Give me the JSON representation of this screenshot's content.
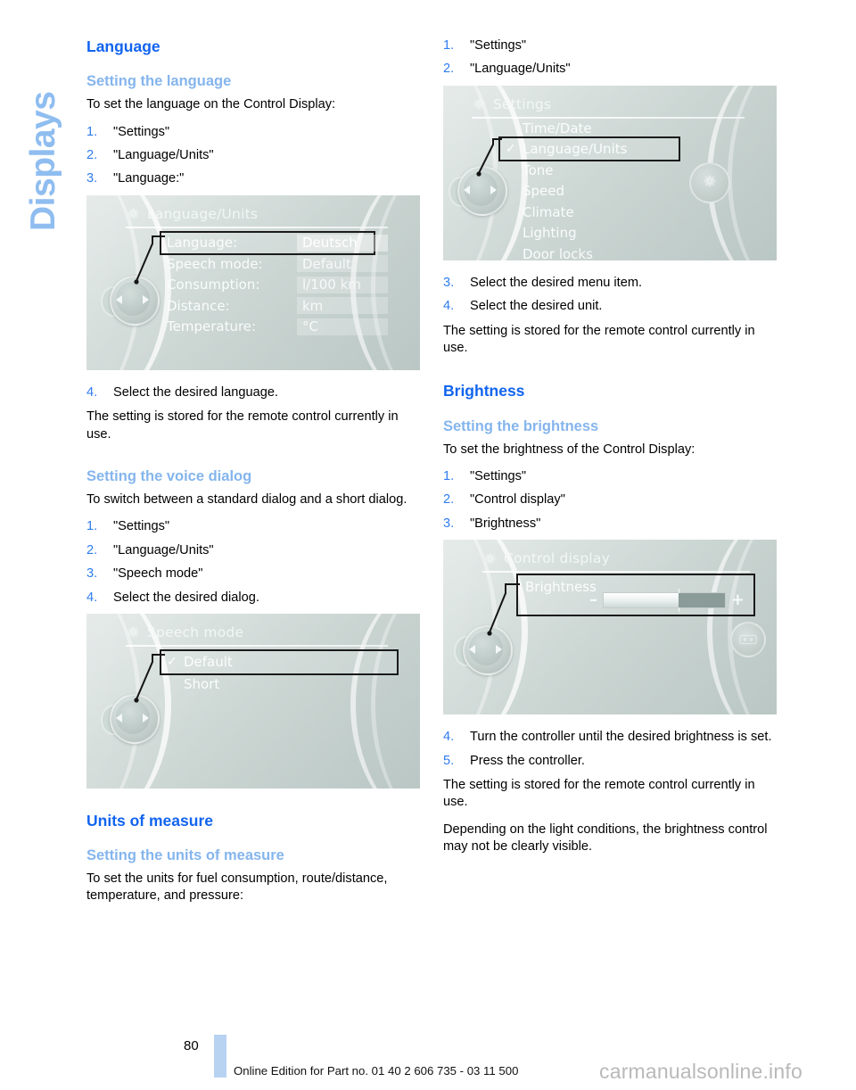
{
  "side_tab": {
    "label": "Displays"
  },
  "page": {
    "number": "80"
  },
  "footer": {
    "edition_text": "Online Edition for Part no. 01 40 2 606 735 - 03 11 500",
    "watermark": "carmanualsonline.info"
  },
  "left_column": {
    "section_title": "Language",
    "sub1": {
      "heading": "Setting the language",
      "intro": "To set the language on the Control Display:",
      "steps": [
        {
          "num": "1.",
          "text": "\"Settings\""
        },
        {
          "num": "2.",
          "text": "\"Language/Units\""
        },
        {
          "num": "3.",
          "text": "\"Language:\""
        }
      ],
      "after_steps": [
        {
          "num": "4.",
          "text": "Select the desired language."
        }
      ],
      "note": "The setting is stored for the remote control currently in use."
    },
    "sub2": {
      "heading": "Setting the voice dialog",
      "intro": "To switch between a standard dialog and a short dialog.",
      "steps": [
        {
          "num": "1.",
          "text": "\"Settings\""
        },
        {
          "num": "2.",
          "text": "\"Language/Units\""
        },
        {
          "num": "3.",
          "text": "\"Speech mode\""
        },
        {
          "num": "4.",
          "text": "Select the desired dialog."
        }
      ]
    },
    "section_title2": "Units of measure",
    "sub3": {
      "heading": "Setting the units of measure",
      "intro": "To set the units for fuel consumption, route/distance, temperature, and pressure:"
    }
  },
  "right_column": {
    "steps_top": [
      {
        "num": "1.",
        "text": "\"Settings\""
      },
      {
        "num": "2.",
        "text": "\"Language/Units\""
      }
    ],
    "steps_mid": [
      {
        "num": "3.",
        "text": "Select the desired menu item."
      },
      {
        "num": "4.",
        "text": "Select the desired unit."
      }
    ],
    "note1": "The setting is stored for the remote control currently in use.",
    "section_title": "Brightness",
    "sub1": {
      "heading": "Setting the brightness",
      "intro": "To set the brightness of the Control Display:",
      "steps": [
        {
          "num": "1.",
          "text": "\"Settings\""
        },
        {
          "num": "2.",
          "text": "\"Control display\""
        },
        {
          "num": "3.",
          "text": "\"Brightness\""
        }
      ]
    },
    "steps_bottom": [
      {
        "num": "4.",
        "text": "Turn the controller until the desired brightness is set."
      },
      {
        "num": "5.",
        "text": "Press the controller."
      }
    ],
    "note2": "The setting is stored for the remote control currently in use.",
    "note3": "Depending on the light conditions, the brightness control may not be clearly visible."
  },
  "screens": {
    "language_units": {
      "title": "Language/Units",
      "rows": [
        {
          "label": "Language:",
          "value": "Deutsch",
          "highlight": true
        },
        {
          "label": "Speech mode:",
          "value": "Default",
          "highlight": false
        },
        {
          "label": "Consumption:",
          "value": "l/100 km",
          "highlight": false
        },
        {
          "label": "Distance:",
          "value": "km",
          "highlight": false
        },
        {
          "label": "Temperature:",
          "value": "°C",
          "highlight": false
        }
      ]
    },
    "speech_mode": {
      "title": "Speech mode",
      "rows": [
        {
          "label": "Default",
          "checked": true,
          "highlight": true
        },
        {
          "label": "Short",
          "checked": false,
          "highlight": false
        }
      ]
    },
    "settings": {
      "title": "Settings",
      "rows": [
        {
          "label": "Time/Date",
          "checked": false,
          "highlight": false
        },
        {
          "label": "Language/Units",
          "checked": true,
          "highlight": true
        },
        {
          "label": "Tone",
          "checked": false,
          "highlight": false
        },
        {
          "label": "Speed",
          "checked": false,
          "highlight": false
        },
        {
          "label": "Climate",
          "checked": false,
          "highlight": false
        },
        {
          "label": "Lighting",
          "checked": false,
          "highlight": false
        },
        {
          "label": "Door locks",
          "checked": false,
          "highlight": false
        }
      ]
    },
    "control_display": {
      "title": "Control display",
      "brightness_label": "Brightness",
      "minus": "–",
      "plus": "+",
      "slider_percent": 62
    }
  },
  "colors": {
    "heading_blue": "#1164ef",
    "subheading_blue": "#85b5ed",
    "step_number_blue": "#2f7cf0",
    "side_tab_blue": "#8fbdf0",
    "footer_bar_blue": "#b8d2f2"
  }
}
